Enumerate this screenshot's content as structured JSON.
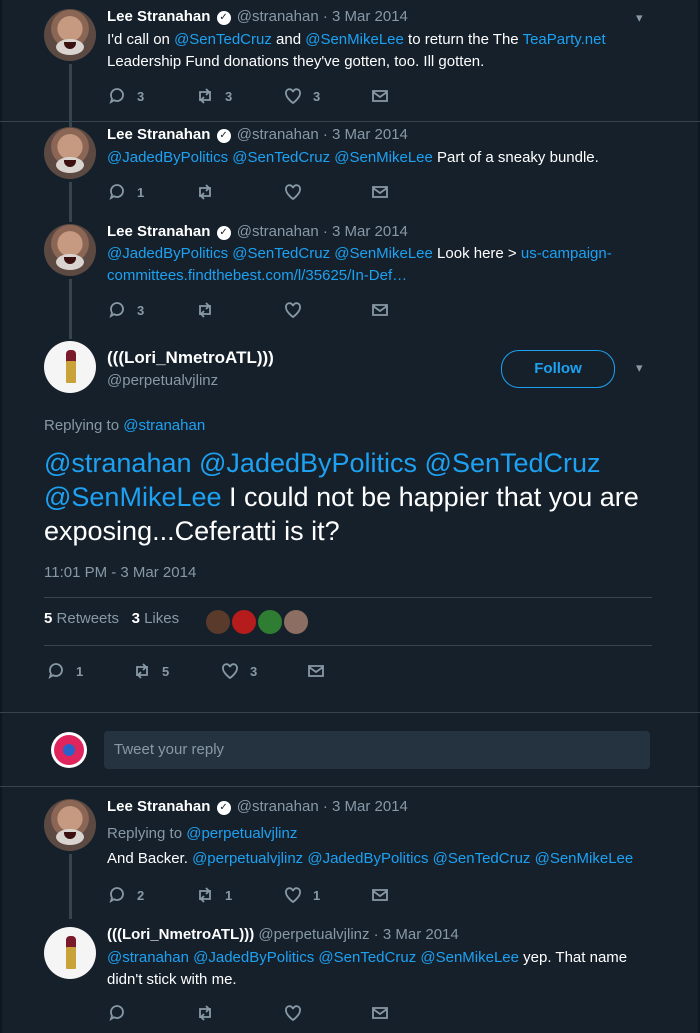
{
  "tweets": {
    "t1": {
      "name": "Lee Stranahan",
      "handle": "@stranahan",
      "sep": "·",
      "date": "3 Mar 2014",
      "p1": "I'd call on ",
      "l1": "@SenTedCruz",
      "p2": " and ",
      "l2": "@SenMikeLee",
      "p3": " to return the The ",
      "l3": "TeaParty.net",
      "p4": " Leadership Fund donations they've gotten, too. Ill gotten.",
      "replies": "3",
      "retweets": "3",
      "likes": "3"
    },
    "t2": {
      "name": "Lee Stranahan",
      "handle": "@stranahan",
      "sep": "·",
      "date": "3 Mar 2014",
      "l1": "@JadedByPolitics",
      "l2": "@SenTedCruz",
      "l3": "@SenMikeLee",
      "p1": " Part of a sneaky bundle.",
      "replies": "1"
    },
    "t3": {
      "name": "Lee Stranahan",
      "handle": "@stranahan",
      "sep": "·",
      "date": "3 Mar 2014",
      "l1": "@JadedByPolitics",
      "l2": "@SenTedCruz",
      "l3": "@SenMikeLee",
      "p1": " Look here > ",
      "l4": "us-campaign-committees.findthebest.com/l/35625/In-Def…",
      "replies": "3"
    },
    "focus": {
      "name": "(((Lori_NmetroATL)))",
      "handle": "@perpetualvjlinz",
      "follow": "Follow",
      "replying_label": "Replying to ",
      "replying_to": "@stranahan",
      "l1": "@stranahan",
      "l2": "@JadedByPolitics",
      "l3": "@SenTedCruz",
      "l4": "@SenMikeLee",
      "p1": " I could not be happier that you are exposing...Ceferatti is it?",
      "timestamp": "11:01 PM - 3 Mar 2014",
      "retweets_count": "5",
      "retweets_label": "Retweets",
      "likes_count": "3",
      "likes_label": "Likes",
      "replies": "1",
      "retweets": "5",
      "likes": "3"
    },
    "compose": {
      "placeholder": "Tweet your reply"
    },
    "t4": {
      "name": "Lee Stranahan",
      "handle": "@stranahan",
      "sep": "·",
      "date": "3 Mar 2014",
      "replying_label": "Replying to ",
      "replying_to": "@perpetualvjlinz",
      "p1": "And Backer. ",
      "l1": "@perpetualvjlinz",
      "l2": "@JadedByPolitics",
      "l3": "@SenTedCruz",
      "l4": "@SenMikeLee",
      "replies": "2",
      "retweets": "1",
      "likes": "1"
    },
    "t5": {
      "name": "(((Lori_NmetroATL)))",
      "handle": "@perpetualvjlinz",
      "sep": "·",
      "date": "3 Mar 2014",
      "l1": "@stranahan",
      "l2": "@JadedByPolitics",
      "l3": "@SenTedCruz",
      "l4": "@SenMikeLee",
      "p1": " yep.  That name didn't stick with me."
    }
  },
  "colors": {
    "background": "#15202b",
    "link": "#1da1f2",
    "muted": "#8899a6",
    "divider": "#38444d"
  },
  "icons": {
    "reply": "reply-icon",
    "retweet": "retweet-icon",
    "like": "heart-icon",
    "dm": "envelope-icon",
    "menu": "chevron-down-icon",
    "verified": "verified-badge-icon"
  }
}
